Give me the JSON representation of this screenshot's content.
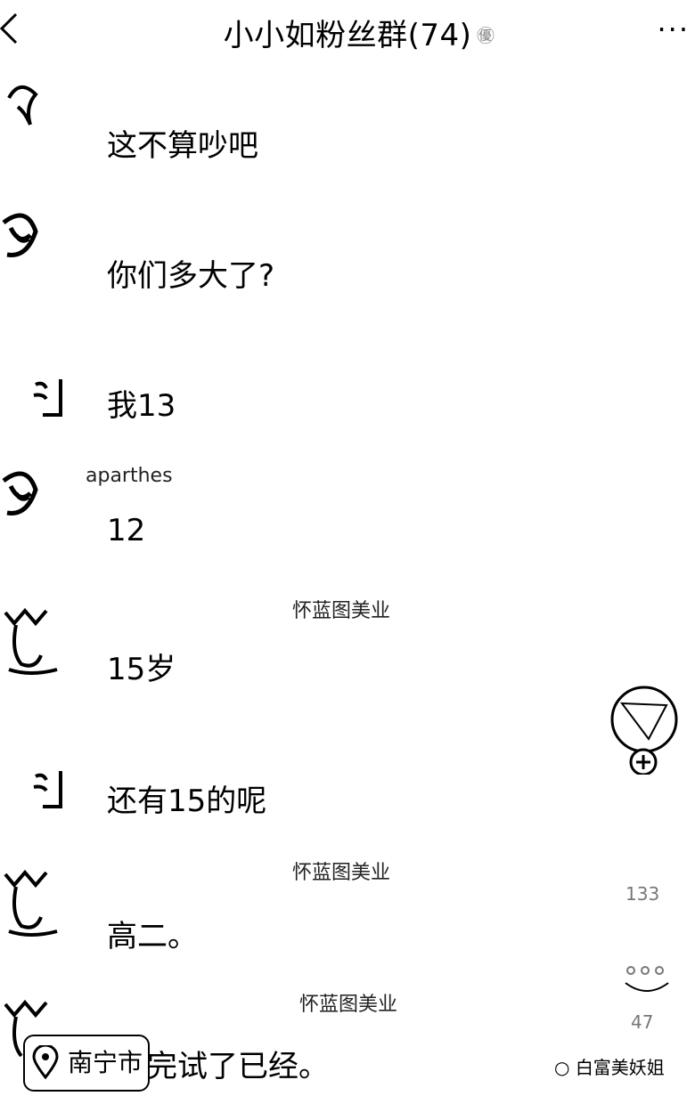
{
  "header": {
    "title": "小小如粉丝群(74)",
    "title_extra": "㊝",
    "more": "···"
  },
  "messages": [
    {
      "sender": "",
      "text": "这不算吵吧"
    },
    {
      "sender": "",
      "text": "你们多大了?"
    },
    {
      "sender": "",
      "text": "我13"
    },
    {
      "sender": "aparthes",
      "text": "12"
    },
    {
      "sender": "怀蓝图美业",
      "text": "15岁"
    },
    {
      "sender": "",
      "text": "还有15的呢"
    },
    {
      "sender": "怀蓝图美业",
      "text": "高二。"
    },
    {
      "sender": "怀蓝图美业",
      "text": "完试了已经。"
    }
  ],
  "side": {
    "count_a": "133",
    "count_b": "47"
  },
  "location": {
    "label": "南宁市"
  },
  "watermark": {
    "text": "白富美妖姐"
  }
}
